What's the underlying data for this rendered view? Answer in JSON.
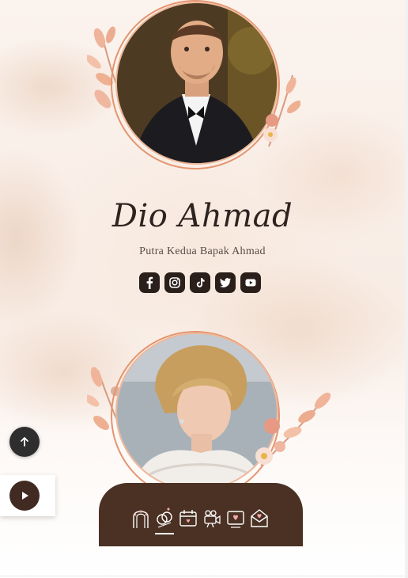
{
  "groom": {
    "name": "Dio Ahmad",
    "subtitle": "Putra Kedua Bapak Ahmad",
    "social": [
      "facebook-icon",
      "instagram-icon",
      "tiktok-icon",
      "twitter-icon",
      "youtube-icon"
    ]
  },
  "colors": {
    "accent": "#e3956f",
    "dark": "#2b1f1b",
    "nav_bg": "#4a3123"
  },
  "nav": {
    "items": [
      "wedding-arch-icon",
      "rings-icon",
      "calendar-icon",
      "video-camera-icon",
      "photo-heart-icon",
      "envelope-heart-icon"
    ],
    "active_index": 1
  },
  "controls": {
    "scroll_top_icon": "arrow-up-icon",
    "music_icon": "play-icon"
  }
}
